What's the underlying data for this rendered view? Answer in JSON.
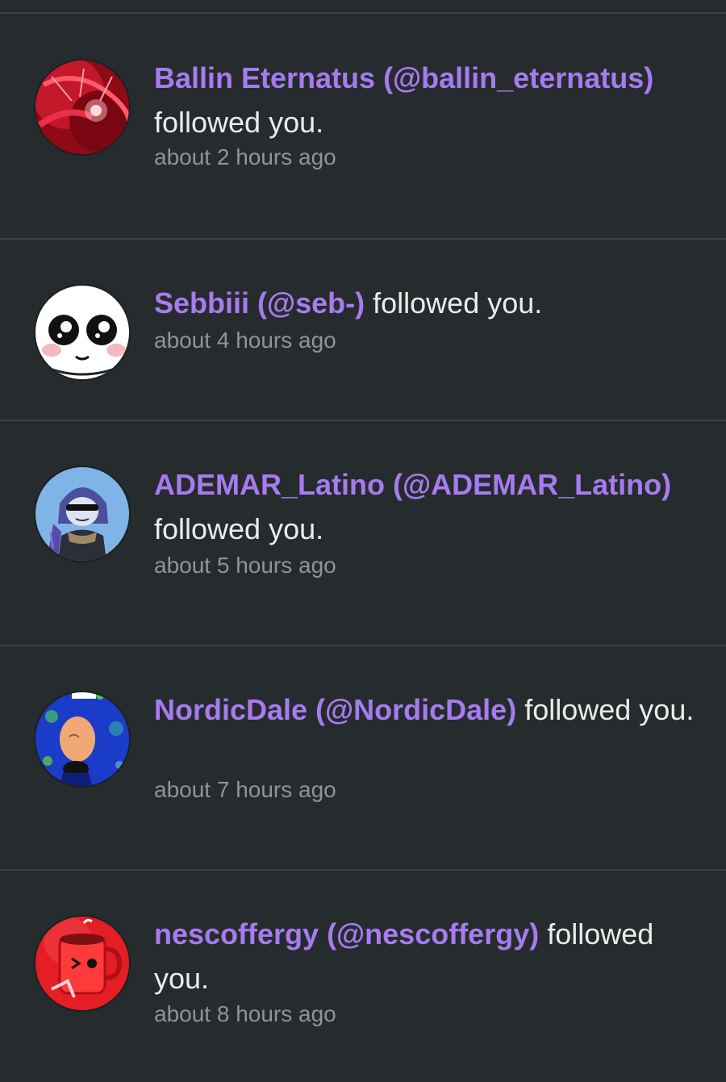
{
  "notifications": [
    {
      "user_link": "Ballin Eternatus (@ballin_eternatus)",
      "action": "followed you.",
      "time": "about 2 hours ago",
      "avatar_icon": "red-abstract-avatar"
    },
    {
      "user_link": "Sebbiii (@seb-)",
      "action": "followed you.",
      "time": "about 4 hours ago",
      "avatar_icon": "cartoon-face-avatar"
    },
    {
      "user_link": "ADEMAR_Latino (@ADEMAR_Latino)",
      "action": "followed you.",
      "time": "about 5 hours ago",
      "avatar_icon": "anime-character-avatar"
    },
    {
      "user_link": "NordicDale (@NordicDale)",
      "action": "followed you.",
      "time": "about 7 hours ago",
      "avatar_icon": "egg-character-avatar"
    },
    {
      "user_link": "nescoffergy (@nescoffergy)",
      "action": "followed you.",
      "time": "about 8 hours ago",
      "avatar_icon": "red-mug-avatar"
    }
  ],
  "colors": {
    "background": "#262b2d",
    "divider": "#3e4446",
    "link": "#a77bf0",
    "text": "#ececec",
    "muted": "#8f9597"
  }
}
